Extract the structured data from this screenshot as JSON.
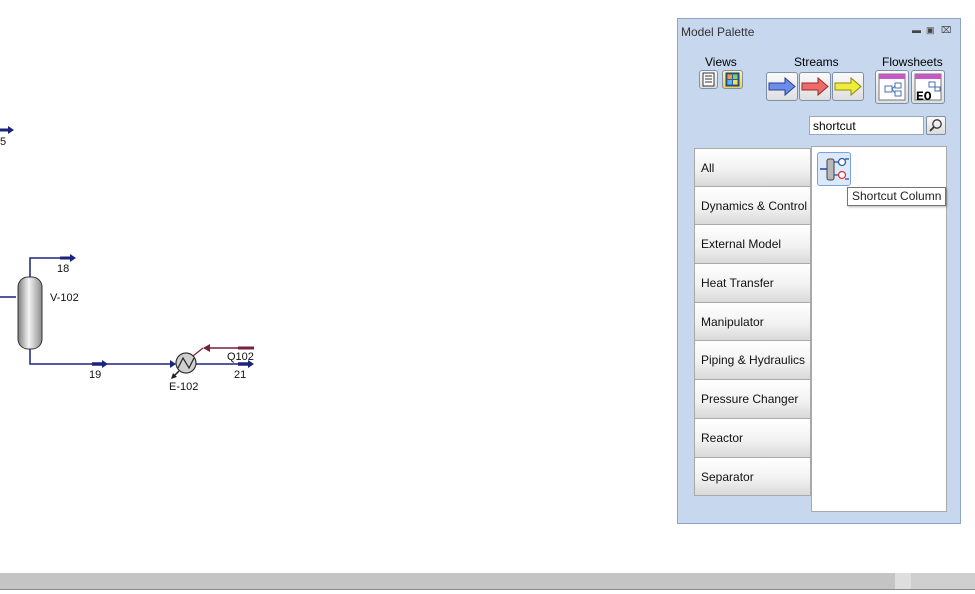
{
  "flowsheet": {
    "stream_5": "5",
    "stream_18": "18",
    "stream_19": "19",
    "stream_21": "21",
    "stream_q102": "Q102",
    "vessel_label": "V-102",
    "exchanger_label": "E-102"
  },
  "palette": {
    "title": "Model Palette",
    "groups": {
      "views": "Views",
      "streams": "Streams",
      "flowsheets": "Flowsheets"
    },
    "search": {
      "value": "shortcut"
    },
    "categories": [
      "All",
      "Dynamics & Control",
      "External Model",
      "Heat Transfer",
      "Manipulator",
      "Piping & Hydraulics",
      "Pressure Changer",
      "Reactor",
      "Separator"
    ],
    "result_tooltip": "Shortcut Column",
    "flowsheet_eo_text": "EO"
  },
  "colors": {
    "stream_material": "#1a237e",
    "stream_energy": "#7b1f3a",
    "palette_bg": "#c6d7ee"
  }
}
